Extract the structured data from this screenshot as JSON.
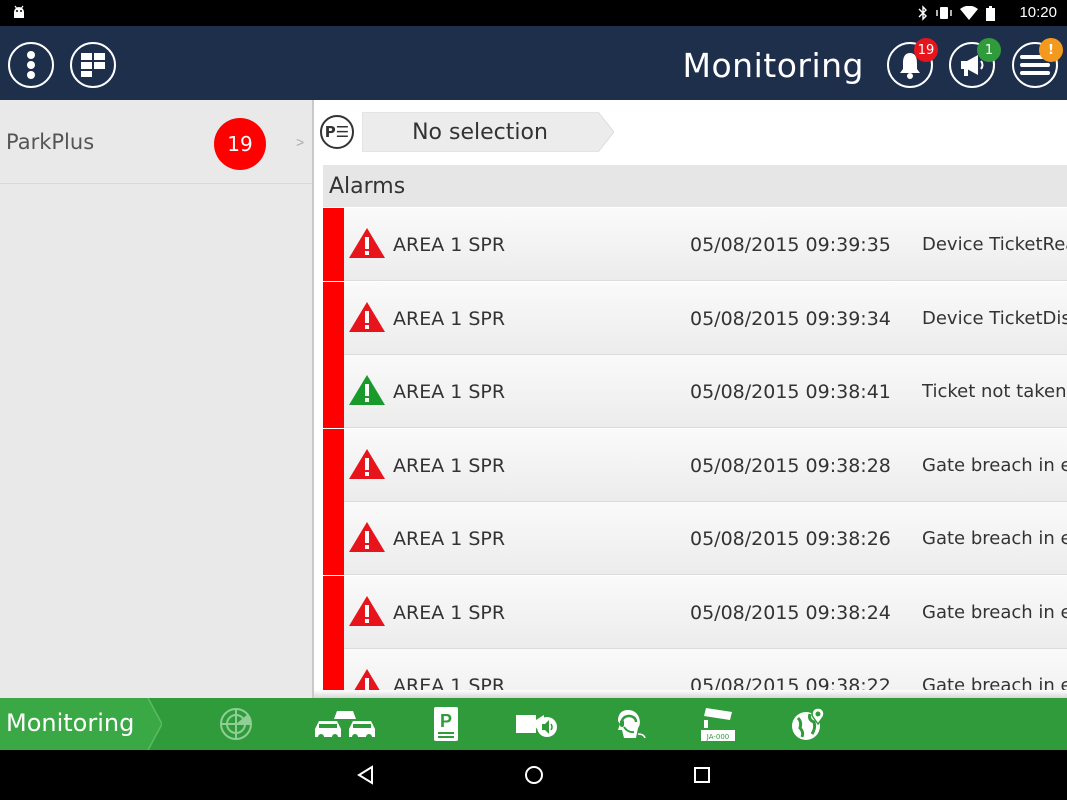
{
  "status_bar": {
    "time": "10:20"
  },
  "header": {
    "title": "Monitoring",
    "menu_button": "more-vert",
    "grid_button": "apps",
    "alerts": {
      "icon": "bell-icon",
      "count": "19",
      "badge_color": "#e8141b"
    },
    "announcements": {
      "icon": "megaphone-icon",
      "count": "1",
      "badge_color": "#2f9b3a"
    },
    "menu": {
      "icon": "hamburger-icon",
      "badge": "!",
      "badge_color": "#f39a1e"
    }
  },
  "sidebar": {
    "items": [
      {
        "label": "ParkPlus",
        "count": "19",
        "chevron": ">"
      }
    ]
  },
  "breadcrumb": {
    "icon_label": "P☰",
    "selection": "No selection"
  },
  "alarms": {
    "title": "Alarms",
    "rows": [
      {
        "area": "AREA 1 SPR",
        "time": "05/08/2015 09:39:35",
        "desc": "Device TicketReader",
        "severity": "red"
      },
      {
        "area": "AREA 1 SPR",
        "time": "05/08/2015 09:39:34",
        "desc": "Device TicketDispenser",
        "severity": "red"
      },
      {
        "area": "AREA 1 SPR",
        "time": "05/08/2015 09:38:41",
        "desc": "Ticket not taken",
        "severity": "green"
      },
      {
        "area": "AREA 1 SPR",
        "time": "05/08/2015 09:38:28",
        "desc": "Gate breach in entry",
        "severity": "red"
      },
      {
        "area": "AREA 1 SPR",
        "time": "05/08/2015 09:38:26",
        "desc": "Gate breach in entry",
        "severity": "red"
      },
      {
        "area": "AREA 1 SPR",
        "time": "05/08/2015 09:38:24",
        "desc": "Gate breach in entry",
        "severity": "red"
      },
      {
        "area": "AREA 1 SPR",
        "time": "05/08/2015 09:38:22",
        "desc": "Gate breach in entry",
        "severity": "red"
      }
    ]
  },
  "bottom_nav": {
    "active_label": "Monitoring",
    "icons": [
      "radar-icon",
      "traffic-cars-icon",
      "parking-ticket-icon",
      "camera-speaker-icon",
      "operator-headset-icon",
      "license-plate-camera-icon",
      "globe-location-icon"
    ],
    "plate_text": "JA-000",
    "parking_letter": "P"
  },
  "colors": {
    "appbar": "#1e2f4c",
    "accent_green": "#2f9b3a",
    "alarm_red": "#ff0000",
    "ok_green": "#1a9a2a"
  }
}
